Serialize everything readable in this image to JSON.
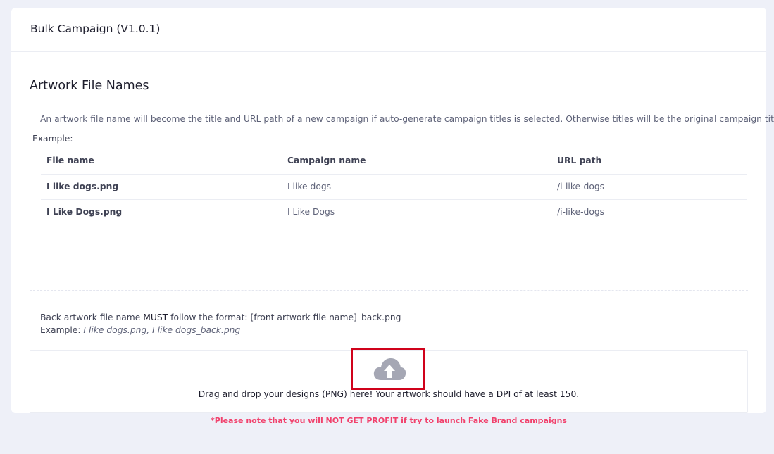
{
  "header": {
    "title": "Bulk Campaign (V1.0.1)"
  },
  "section": {
    "title": "Artwork File Names",
    "description": "An artwork file name will become the title and URL path of a new campaign if auto-generate campaign titles is selected. Otherwise titles will be the original campaign title.",
    "example_label": "Example:"
  },
  "table": {
    "headers": [
      "File name",
      "Campaign name",
      "URL path"
    ],
    "rows": [
      [
        "I like dogs.png",
        "I like dogs",
        "/i-like-dogs"
      ],
      [
        "I Like Dogs.png",
        "I Like Dogs",
        "/i-like-dogs"
      ]
    ]
  },
  "back_note": {
    "prefix": "Back artwork file name ",
    "must": "MUST",
    "suffix": " follow the format: [front artwork file name]_back.png",
    "example_label": "Example: ",
    "example_value": "I like dogs.png, I like dogs_back.png"
  },
  "dropzone": {
    "icon": "cloud-upload-icon",
    "text": "Drag and drop your designs (PNG) here! Your artwork should have a DPI of at least 150."
  },
  "warning": "*Please note that you will NOT GET PROFIT if try to launch Fake Brand campaigns",
  "colors": {
    "warning": "#f1416c",
    "highlight": "#d0021b",
    "icon": "#a5a7b4"
  }
}
